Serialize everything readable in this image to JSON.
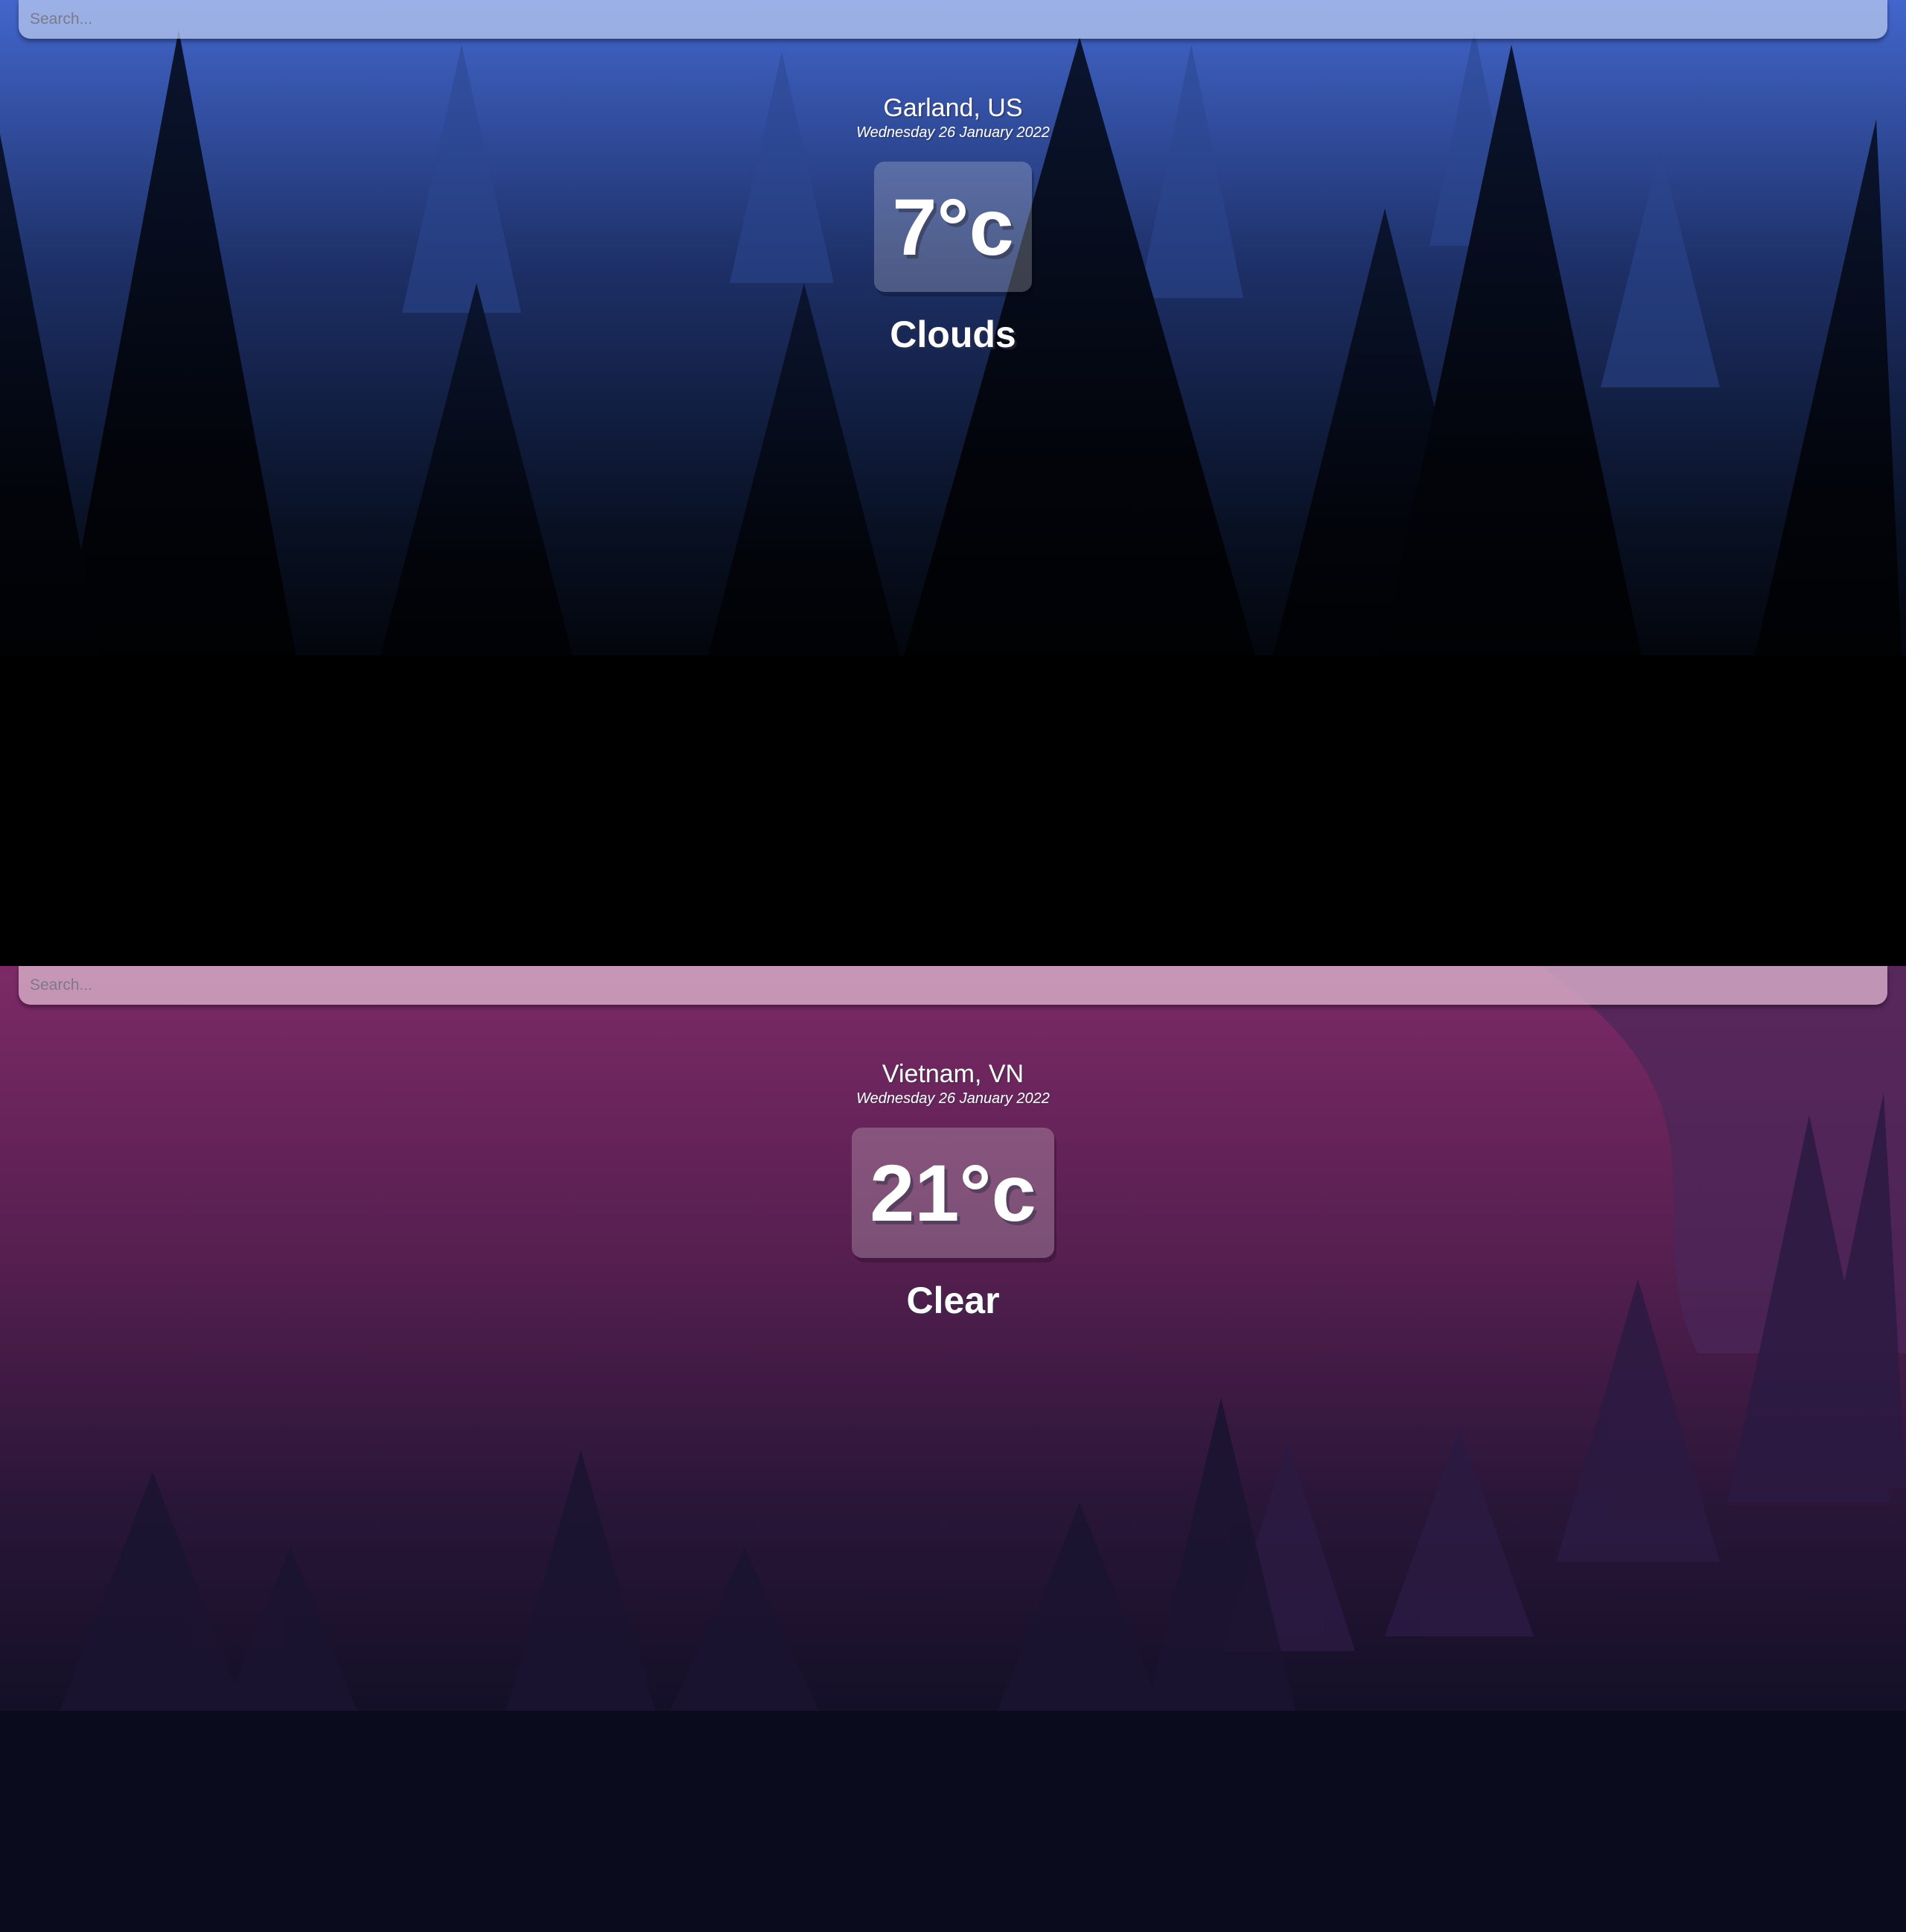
{
  "panels": [
    {
      "theme": "cold",
      "search": {
        "placeholder": "Search..."
      },
      "location": "Garland, US",
      "date": "Wednesday 26 January 2022",
      "temperature": "7°c",
      "weather": "Clouds"
    },
    {
      "theme": "warm",
      "search": {
        "placeholder": "Search..."
      },
      "location": "Vietnam, VN",
      "date": "Wednesday 26 January 2022",
      "temperature": "21°c",
      "weather": "Clear"
    }
  ],
  "colors": {
    "cold_sky": "#3a5fc8",
    "cold_ground": "#000000",
    "warm_sky": "#7a2a63",
    "warm_ground": "#0b0b1d"
  }
}
